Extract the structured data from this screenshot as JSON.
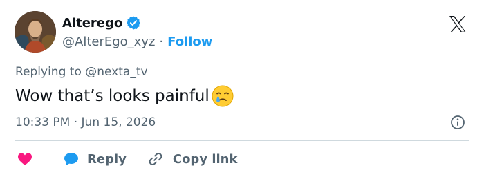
{
  "author": {
    "display_name": "Alterego",
    "handle": "@AlterEgo_xyz",
    "follow_label": "Follow",
    "separator": "·"
  },
  "tweet": {
    "replying_to_prefix": "Replying to",
    "replying_to_handle": "@nexta_tv",
    "text": "Wow that’s looks painful",
    "emoji": "crying-face-emoji",
    "time": "10:33 PM",
    "date": "Jun 15, 2026",
    "separator": "·"
  },
  "actions": {
    "reply_label": "Reply",
    "copy_link_label": "Copy link"
  },
  "icons": {
    "platform": "x-logo-icon",
    "verified": "verified-badge-icon",
    "info": "info-icon",
    "like": "heart-icon",
    "reply": "speech-bubble-icon",
    "copy_link": "link-icon"
  },
  "colors": {
    "accent": "#1d9bf0",
    "like": "#f91880",
    "text_primary": "#0f1419",
    "text_secondary": "#536471",
    "divider": "#cfd9de"
  }
}
